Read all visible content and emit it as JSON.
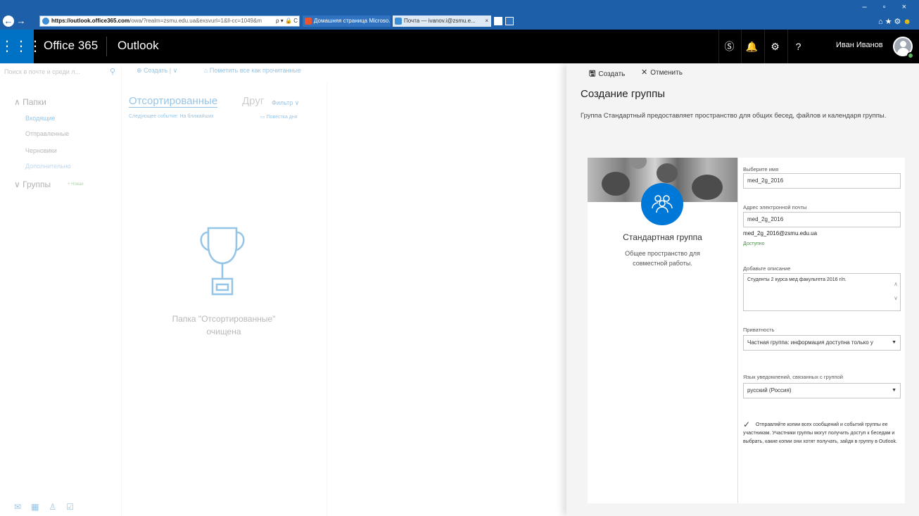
{
  "browser": {
    "url_host": "https://outlook.office365.com",
    "url_rest": "/owa/?realm=zsmu.edu.ua&exsvurl=1&ll-cc=1049&m",
    "url_controls": "ρ ▾ 🔒 C",
    "tab1_title": "Домашняя страница Microso...",
    "tab2_title": "Почта — ivanov.i@zsmu.e...",
    "tab2_close": "×",
    "window_controls": "– ▫ ×"
  },
  "header": {
    "brand": "Office 365",
    "app": "Outlook",
    "user_name": "Иван Иванов"
  },
  "mail": {
    "search_placeholder": "Поиск в почте и среди л...",
    "new_label": "⊕ Создать | ∨",
    "mark_read_label": "⌂ Пометить все как прочитанные",
    "folders_title": "Папки",
    "folders": [
      "Входящие",
      "Отправленные",
      "Черновики",
      "Дополнительно"
    ],
    "groups_title": "Группы",
    "groups_new": "+ Новая",
    "pivot_focused": "Отсортированные",
    "pivot_other": "Друг",
    "filter": "Фильтр ∨",
    "next_event": "Следующее событие: На ближайших",
    "agenda": "Повестка дня",
    "empty_line1": "Папка \"Отсортированные\"",
    "empty_line2": "очищена"
  },
  "panel": {
    "create_label": "Создать",
    "cancel_label": "Отменить",
    "title": "Создание группы",
    "description": "Группа Стандартный предоставляет пространство для общих бесед, файлов и календаря группы.",
    "card": {
      "name": "Стандартная группа",
      "description": "Общее пространство для совместной работы."
    },
    "form": {
      "name_label": "Выберите имя",
      "name_value": "med_2g_2016",
      "email_label": "Адрес электронной почты",
      "email_value": "med_2g_2016",
      "email_full": "med_2g_2016@zsmu.edu.ua",
      "email_status": "Доступно",
      "desc_label": "Добавьте описание",
      "desc_value": "Студенты 2 курса мед факультета 2016 г/п.",
      "privacy_label": "Приватность",
      "privacy_value": "Частная группа: информация доступна только у",
      "lang_label": "Язык уведомлений, связанных с группой",
      "lang_value": "русский (Россия)",
      "checkbox_text": "Отправляйте копии всех сообщений и событий группы ее участникам. Участники группы могут получить доступ к беседам и выбрать, какие копии они хотят получать, зайдя в группу в Outlook.",
      "checkbox_checked": true
    }
  },
  "colors": {
    "accent": "#0072c6",
    "header_bg": "#000000",
    "browser_bg": "#1e5fa9",
    "available": "#3a9a3a"
  },
  "icons": [
    "waffle-icon",
    "skype-icon",
    "bell-icon",
    "gear-icon",
    "help-icon",
    "search-icon",
    "trophy-icon",
    "save-icon",
    "close-icon",
    "group-icon"
  ]
}
